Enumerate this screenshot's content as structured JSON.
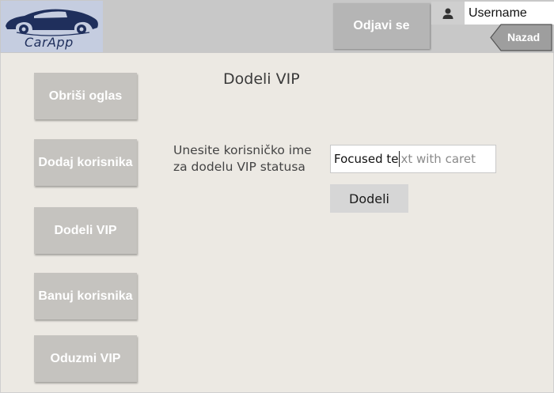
{
  "header": {
    "logo_text": "CarApp",
    "logout_label": "Odjavi se",
    "username_value": "Username",
    "back_label": "Nazad"
  },
  "sidebar": {
    "items": [
      {
        "label": "Obriši oglas"
      },
      {
        "label": "Dodaj korisnika"
      },
      {
        "label": "Dodeli VIP"
      },
      {
        "label": "Banuj korisnika"
      },
      {
        "label": "Oduzmi VIP"
      }
    ]
  },
  "main": {
    "title": "Dodeli VIP",
    "prompt": "Unesite korisničko ime za dodelu VIP statusa",
    "input_typed": "Focused te",
    "input_placeholder_rest": "xt with caret",
    "assign_label": "Dodeli"
  },
  "icons": {
    "logo": "car-logo-icon",
    "user": "user-icon",
    "back": "back-arrow-icon"
  },
  "colors": {
    "header_bg": "#c8c8c8",
    "main_bg": "#ece9e3",
    "button_bg": "#c5c3bf",
    "logo_bg": "#c5cde0",
    "back_button_bg": "#9e9e9e"
  }
}
